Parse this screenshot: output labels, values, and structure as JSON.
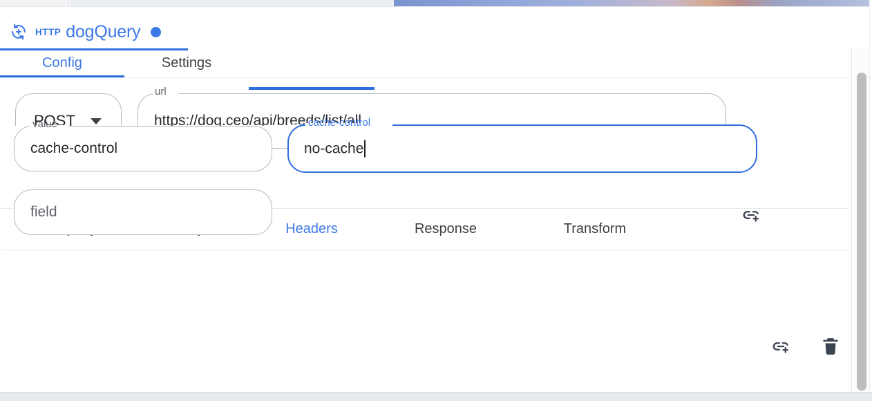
{
  "node_header": {
    "icon": "http-sync-icon",
    "protocol": "HTTP",
    "title": "dogQuery",
    "status_dot": "blue-status-dot",
    "accent_color": "#3b78e7"
  },
  "top_tabs": {
    "items": [
      {
        "label": "Config",
        "active": true
      },
      {
        "label": "Settings",
        "active": false
      }
    ]
  },
  "request": {
    "method": {
      "value": "POST",
      "arrow_icon": "chevron-down-icon"
    },
    "url": {
      "label": "url",
      "value": "https://dog.ceo/api/breeds/list/all"
    },
    "link_button_icon": "add-link-icon"
  },
  "sub_tabs": {
    "items": [
      {
        "label": "URL query",
        "active": false
      },
      {
        "label": "Body",
        "active": false
      },
      {
        "label": "Headers",
        "active": true
      },
      {
        "label": "Response",
        "active": false
      },
      {
        "label": "Transform",
        "active": false
      }
    ]
  },
  "headers": {
    "rows": [
      {
        "value_field": {
          "label": "value",
          "value": "cache-control"
        },
        "key_field": {
          "label": "cache-control",
          "value": "no-cache",
          "focused": true
        },
        "link_button_icon": "add-link-icon",
        "delete_button_icon": "trash-icon"
      }
    ],
    "new_row": {
      "placeholder": "field"
    }
  },
  "scrollbar": {
    "name": "vertical-scrollbar",
    "thumb_color": "#bdbdbd"
  },
  "colors": {
    "accent": "#3b78e7",
    "underline": "#2f6ee0",
    "outline": "#b5b8bb",
    "text": "#26282b",
    "muted_text": "#5f6368",
    "divider": "#e8eaed",
    "bottom_bar": "#e6e9ed"
  }
}
